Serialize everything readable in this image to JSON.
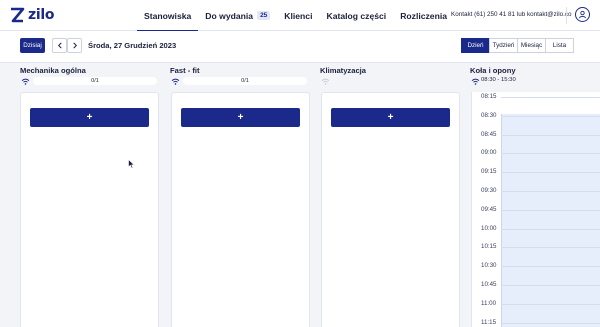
{
  "brand": {
    "name": "zilo",
    "accent": "#1b2a8a"
  },
  "nav": {
    "items": [
      {
        "label": "Stanowiska",
        "active": true
      },
      {
        "label": "Do wydania",
        "badge": "25"
      },
      {
        "label": "Klienci"
      },
      {
        "label": "Katalog części"
      },
      {
        "label": "Rozliczenia"
      }
    ]
  },
  "header": {
    "contact": "Kontakt (61) 250 41 81 lub kontakt@zilo.co",
    "user_icon": "user-circle-icon"
  },
  "toolbar": {
    "today_label": "Dzisiaj",
    "prev_icon": "chevron-left-icon",
    "next_icon": "chevron-right-icon",
    "date_label": "Środa, 27 Grudzień 2023",
    "views": [
      {
        "label": "Dzień",
        "active": true
      },
      {
        "label": "Tydzień"
      },
      {
        "label": "Miesiąc"
      },
      {
        "label": "Lista"
      }
    ]
  },
  "stations": [
    {
      "title": "Mechanika ogólna",
      "progress_text": "0/1",
      "wifi_active": true,
      "add_label": "+"
    },
    {
      "title": "Fast - fit",
      "progress_text": "0/1",
      "wifi_active": true,
      "add_label": "+"
    },
    {
      "title": "Klimatyzacja",
      "progress_text": "",
      "wifi_active": false,
      "add_label": "+"
    }
  ],
  "timeline_station": {
    "title": "Koła i opony",
    "hours": "08:30 - 15:30",
    "slots": [
      "08:15",
      "08:30",
      "08:45",
      "09:00",
      "09:15",
      "09:30",
      "09:45",
      "10:00",
      "10:15",
      "10:30",
      "10:45",
      "11:00",
      "11:15"
    ]
  }
}
